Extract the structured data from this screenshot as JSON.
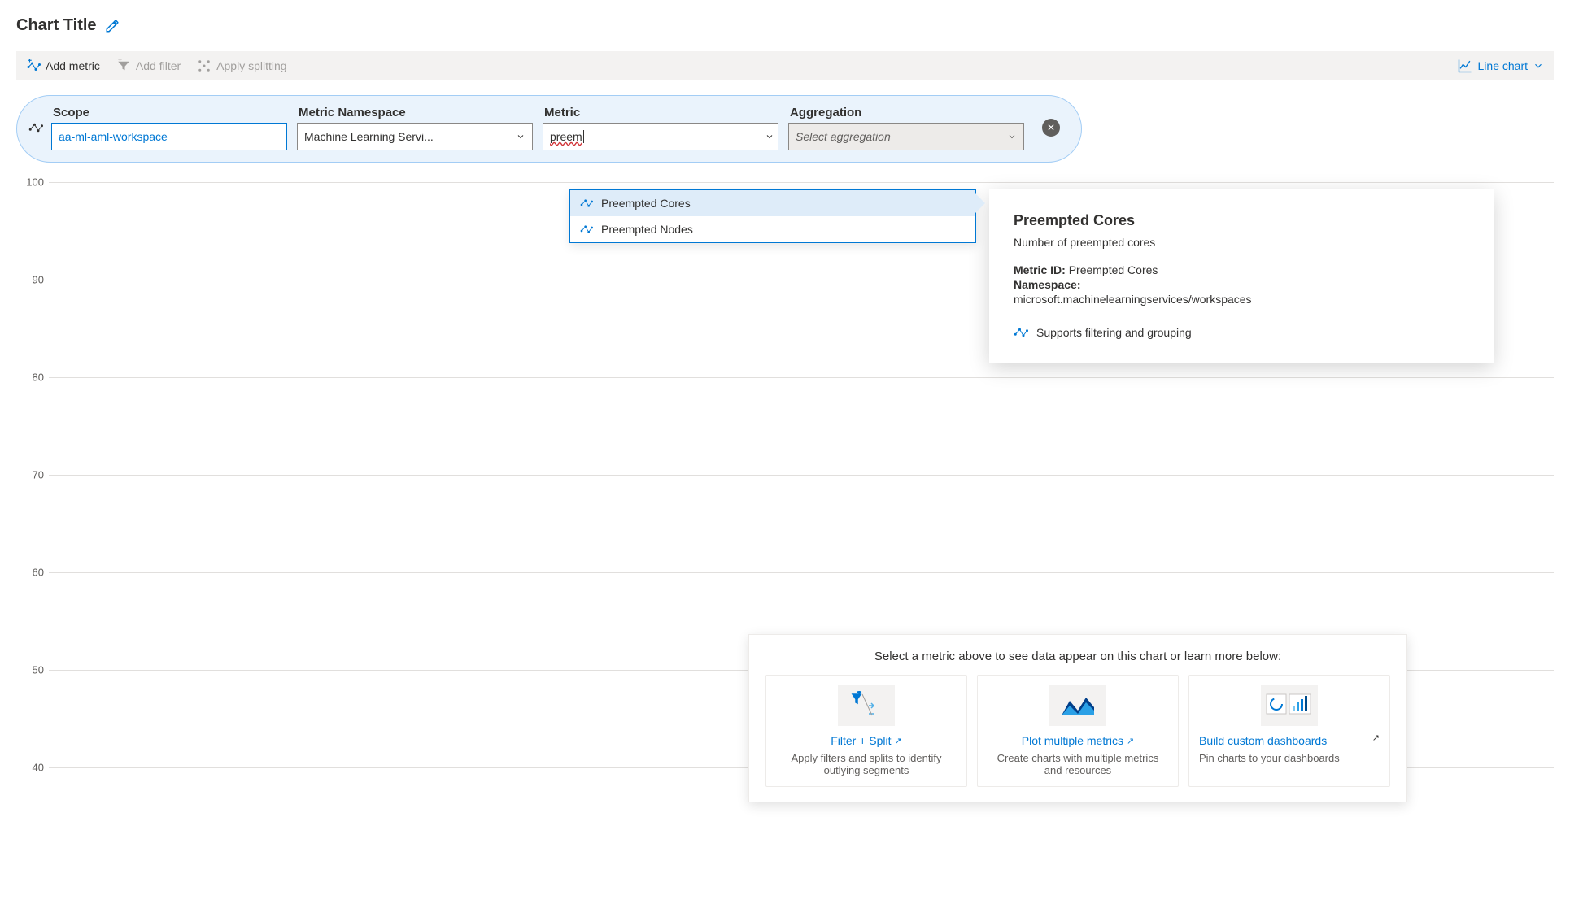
{
  "title": "Chart Title",
  "toolbar": {
    "add_metric": "Add metric",
    "add_filter": "Add filter",
    "apply_splitting": "Apply splitting",
    "chart_type": "Line chart"
  },
  "picker": {
    "scope_label": "Scope",
    "scope_value": "aa-ml-aml-workspace",
    "namespace_label": "Metric Namespace",
    "namespace_value": "Machine Learning Servi...",
    "metric_label": "Metric",
    "metric_value": "preem",
    "aggregation_label": "Aggregation",
    "aggregation_placeholder": "Select aggregation"
  },
  "dropdown": {
    "items": [
      "Preempted Cores",
      "Preempted Nodes"
    ]
  },
  "tooltip": {
    "title": "Preempted Cores",
    "desc": "Number of preempted cores",
    "metric_id_label": "Metric ID:",
    "metric_id_value": "Preempted Cores",
    "namespace_label": "Namespace:",
    "namespace_value": "microsoft.machinelearningservices/workspaces",
    "supports": "Supports filtering and grouping"
  },
  "chart_data": {
    "type": "line",
    "title": "",
    "xlabel": "",
    "ylabel": "",
    "ylim": [
      40,
      100
    ],
    "yticks": [
      100,
      90,
      80,
      70,
      60,
      50,
      40
    ],
    "series": []
  },
  "promo": {
    "header": "Select a metric above to see data appear on this chart or learn more below:",
    "cards": [
      {
        "link": "Filter + Split",
        "sub": "Apply filters and splits to identify outlying segments"
      },
      {
        "link": "Plot multiple metrics",
        "sub": "Create charts with multiple metrics and resources"
      },
      {
        "link": "Build custom dashboards",
        "sub": "Pin charts to your dashboards"
      }
    ]
  }
}
